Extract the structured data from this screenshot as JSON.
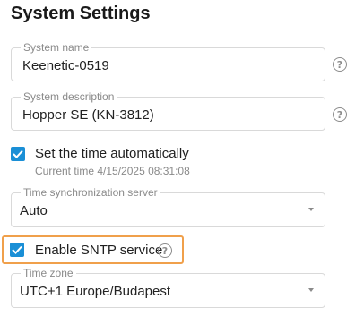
{
  "page": {
    "title": "System Settings"
  },
  "fields": {
    "system_name": {
      "label": "System name",
      "value": "Keenetic-0519"
    },
    "system_description": {
      "label": "System description",
      "value": "Hopper SE (KN-3812)"
    },
    "time_server": {
      "label": "Time synchronization server",
      "value": "Auto"
    },
    "time_zone": {
      "label": "Time zone",
      "value": "UTC+1 Europe/Budapest"
    }
  },
  "checkboxes": {
    "auto_time": {
      "label": "Set the time automatically",
      "checked": true,
      "sub_text": "Current time 4/15/2025 08:31:08"
    },
    "sntp": {
      "label": "Enable SNTP service",
      "checked": true
    }
  },
  "icons": {
    "help": "?",
    "help_icon_name": "help-circle-icon",
    "check_icon_name": "checkmark-icon"
  },
  "colors": {
    "accent": "#1a8fd6",
    "highlight": "#f0a04b",
    "border": "#d9d9d9",
    "muted_text": "#8a8a8a"
  }
}
